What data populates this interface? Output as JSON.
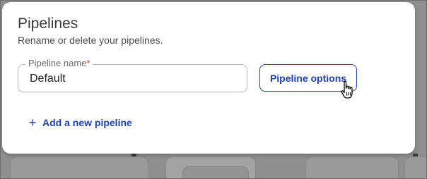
{
  "dialog": {
    "title": "Pipelines",
    "subtitle": "Rename or delete your pipelines."
  },
  "pipeline_field": {
    "label": "Pipeline name",
    "required_marker": "*",
    "value": "Default"
  },
  "actions": {
    "options_label": "Pipeline options",
    "add_label": "Add a new pipeline",
    "add_icon": "+"
  },
  "colors": {
    "accent": "#1f3fb4",
    "required": "#d93025",
    "backdrop": "#8f8f8f"
  },
  "icons": {
    "cursor": "hand-pointer-icon",
    "add": "plus-icon"
  }
}
